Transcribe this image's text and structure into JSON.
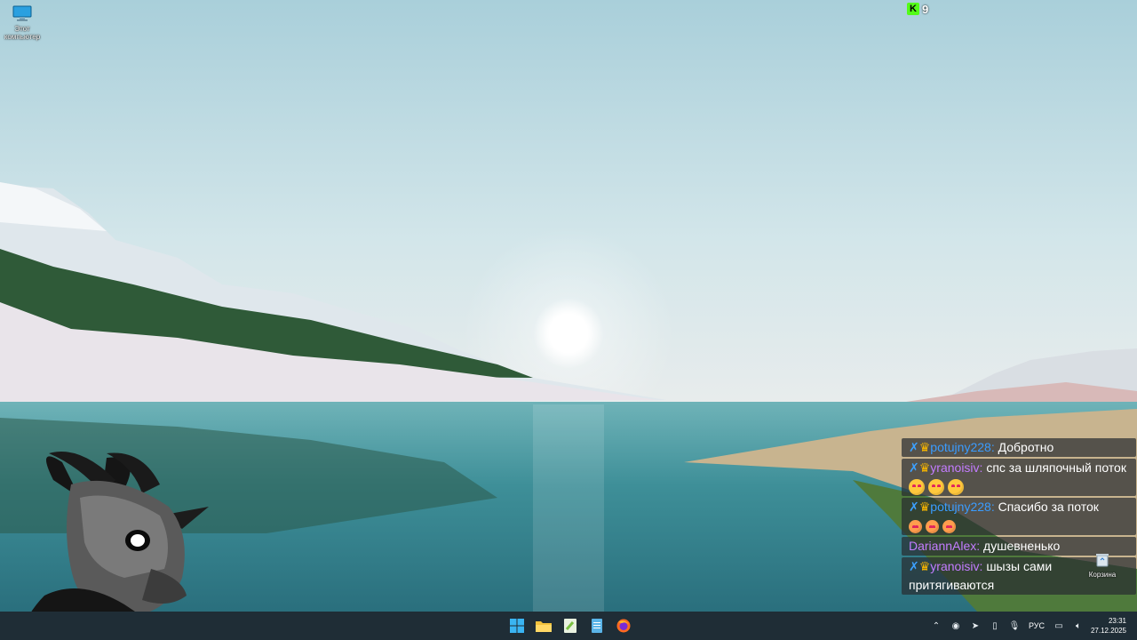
{
  "desktop": {
    "icons": [
      {
        "label": "Этот компьютер"
      },
      {
        "label": "Корзина"
      }
    ]
  },
  "kick": {
    "viewers": "9",
    "logo": "K"
  },
  "chat": {
    "messages": [
      {
        "user": "potujny228",
        "color": "blue",
        "sub": true,
        "text": "Добротно",
        "emotes": 0
      },
      {
        "user": "yranoisiv",
        "color": "purple",
        "sub": true,
        "text": "спс за шляпочный поток",
        "emotes": 3
      },
      {
        "user": "potujny228",
        "color": "blue",
        "sub": true,
        "text": "Спасибо за поток",
        "emotes": 3
      },
      {
        "user": "DariannAlex",
        "color": "purple",
        "sub": false,
        "text": "душевненько",
        "emotes": 0
      },
      {
        "user": "yranoisiv",
        "color": "purple",
        "sub": true,
        "text": "шызы сами притягиваются",
        "emotes": 0
      }
    ],
    "separator": ":"
  },
  "taskbar": {
    "apps": [
      "windows-start",
      "file-explorer",
      "notepad-plus",
      "notepad",
      "firefox"
    ],
    "tray": {
      "language": "РУС",
      "time": "23:31",
      "date": "27.12.2025"
    }
  },
  "colors": {
    "taskbar": "#1f2d36",
    "chat_blue": "#3a9cff",
    "chat_purple": "#c37cff",
    "kick_green": "#53fc18"
  }
}
